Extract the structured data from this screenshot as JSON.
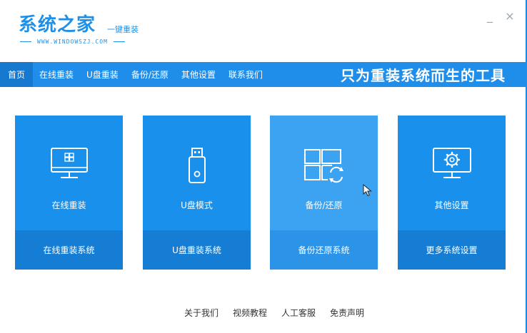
{
  "header": {
    "logo_title": "系统之家",
    "logo_sub": "一键重装",
    "logo_url": "WWW.WINDOWSZJ.COM",
    "minimize_label": "_",
    "close_label": "×"
  },
  "nav": {
    "items": [
      "首页",
      "在线重装",
      "U盘重装",
      "备份/还原",
      "其他设置",
      "联系我们"
    ],
    "active_index": 0,
    "slogan": "只为重装系统而生的工具"
  },
  "cards": [
    {
      "label": "在线重装",
      "action": "在线重装系统",
      "icon": "monitor-windows-icon"
    },
    {
      "label": "U盘模式",
      "action": "U盘重装系统",
      "icon": "usb-drive-icon"
    },
    {
      "label": "备份/还原",
      "action": "备份还原系统",
      "icon": "windows-restore-icon"
    },
    {
      "label": "其他设置",
      "action": "更多系统设置",
      "icon": "monitor-gear-icon"
    }
  ],
  "footer": {
    "links": [
      "关于我们",
      "视频教程",
      "人工客服",
      "免责声明"
    ]
  },
  "colors": {
    "brand": "#1e8eea",
    "card": "#1a90ed",
    "card_bottom": "#157ed4",
    "card_hover": "#3ca3f2"
  }
}
